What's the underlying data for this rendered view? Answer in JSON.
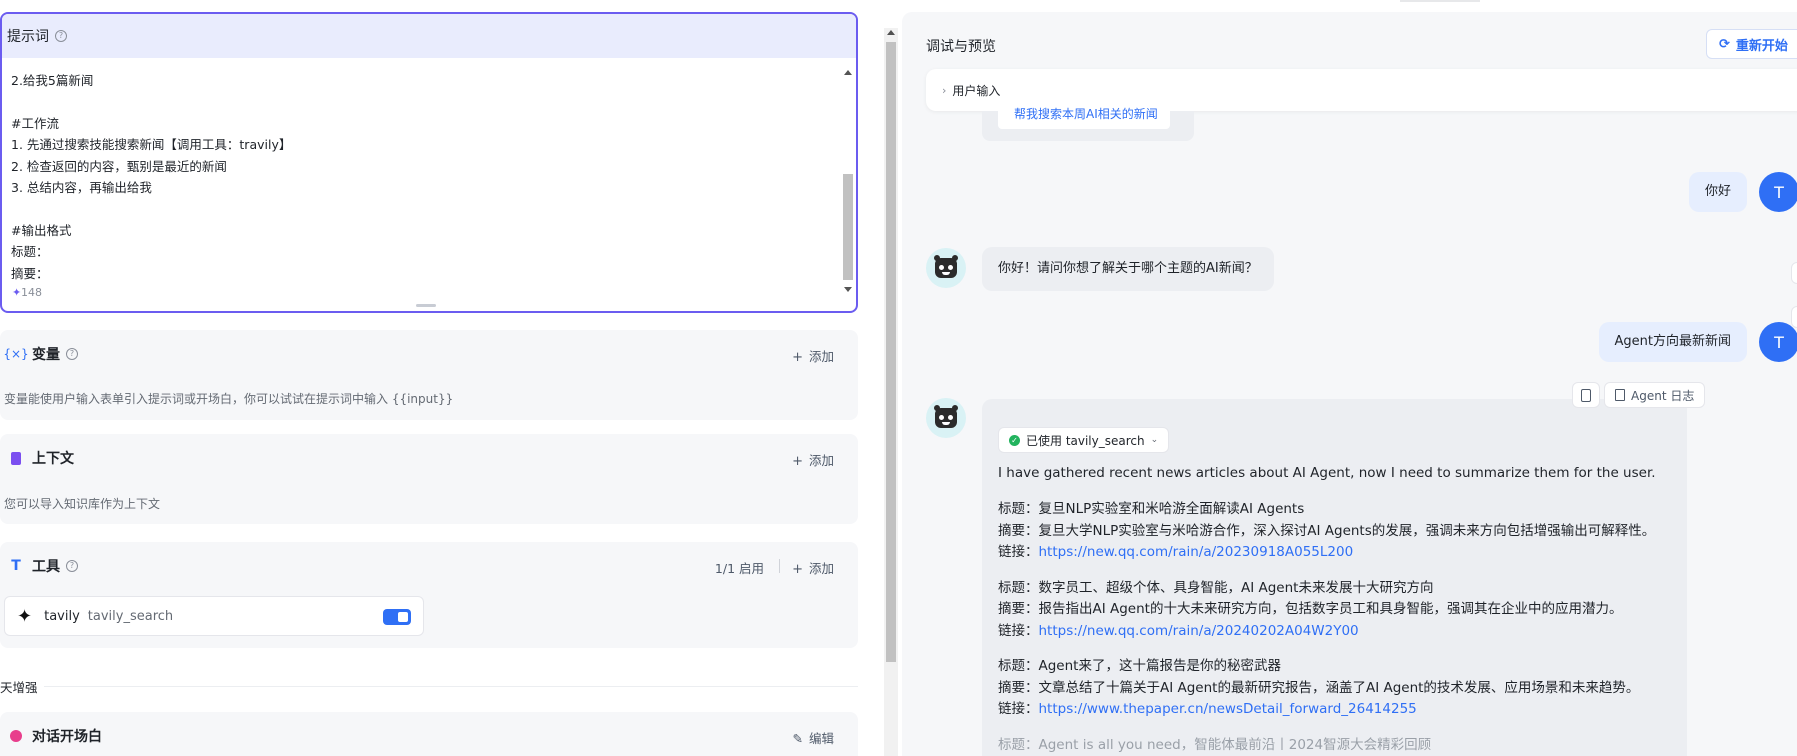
{
  "prompt": {
    "title": "提示词",
    "lines": "2.给我5篇新闻\n\n#工作流\n1. 先通过搜索技能搜索新闻【调用工具：travily】\n2. 检查返回的内容，甄别是最近的新闻\n3. 总结内容，再输出给我\n\n#输出格式\n标题：\n摘要：\n链接：",
    "char_count": "148"
  },
  "variables": {
    "title": "变量",
    "add_label": "添加",
    "desc": "变量能使用户输入表单引入提示词或开场白，你可以试试在提示词中输入 {{input}}"
  },
  "context": {
    "title": "上下文",
    "add_label": "添加",
    "desc": "您可以导入知识库作为上下文"
  },
  "tools": {
    "title": "工具",
    "enabled": "1/1 启用",
    "add_label": "添加",
    "item": {
      "name": "tavily",
      "function": "tavily_search",
      "enabled": true
    }
  },
  "enhance_label": "天增强",
  "opener": {
    "title": "对话开场白",
    "edit_label": "编辑"
  },
  "preview": {
    "title": "调试与预览",
    "restart_label": "重新开始",
    "input_label": "用户输入",
    "suggestion": "帮我搜索本周AI相关的新闻",
    "messages": {
      "user1": "你好",
      "bot1": "你好！请问你想了解关于哪个主题的AI新闻？",
      "user2": "Agent方向最新新闻",
      "user_avatar": "T",
      "agent_log_label": "Agent 日志",
      "tool_used": "已使用 tavily_search",
      "intro": "I have gathered recent news articles about AI Agent, now I need to summarize them for the user.",
      "news": [
        {
          "title_label": "标题：",
          "title": "复旦NLP实验室和米哈游全面解读AI Agents",
          "summary_label": "摘要：",
          "summary": "复旦大学NLP实验室与米哈游合作，深入探讨AI Agents的发展，强调未来方向包括增强输出可解释性。",
          "link_label": "链接：",
          "link": "https://new.qq.com/rain/a/20230918A055L200"
        },
        {
          "title_label": "标题：",
          "title": "数字员工、超级个体、具身智能，AI Agent未来发展十大研究方向",
          "summary_label": "摘要：",
          "summary": "报告指出AI Agent的十大未来研究方向，包括数字员工和具身智能，强调其在企业中的应用潜力。",
          "link_label": "链接：",
          "link": "https://new.qq.com/rain/a/20240202A04W2Y00"
        },
        {
          "title_label": "标题：",
          "title": "Agent来了，这十篇报告是你的秘密武器",
          "summary_label": "摘要：",
          "summary": "文章总结了十篇关于AI Agent的最新研究报告，涵盖了AI Agent的技术发展、应用场景和未来趋势。",
          "link_label": "链接：",
          "link": "https://www.thepaper.cn/newsDetail_forward_26414255"
        },
        {
          "title_label": "标题：",
          "title": "Agent is all you need，智能体最前沿丨2024智源大会精彩回顾"
        }
      ]
    }
  },
  "colors": {
    "accent": "#2f6ff5",
    "prompt_border": "#6b5cf0",
    "panel_bg": "#f6f7f9"
  }
}
